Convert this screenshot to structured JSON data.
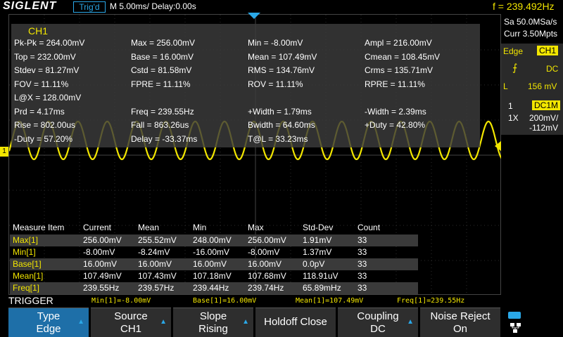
{
  "header": {
    "logo": "SIGLENT",
    "trigger_status": "Trig'd",
    "timebase": "M 5.00ms/ Delay:0.00s",
    "frequency": "f = 239.492Hz"
  },
  "right_panel": {
    "sample_rate": "Sa 50.0MSa/s",
    "memory_depth": "Curr 3.50Mpts",
    "trigger_type": "Edge",
    "trigger_source": "CH1",
    "coupling": "DC",
    "level_label": "L",
    "level_value": "156 mV",
    "channel_number": "1",
    "channel_coupling": "DC1M",
    "probe": "1X",
    "volts_div": "200mV/",
    "offset": "-112mV"
  },
  "measure_panel": {
    "title": "CH1",
    "items": [
      "Pk-Pk = 264.00mV",
      "Max = 256.00mV",
      "Min = -8.00mV",
      "Ampl = 216.00mV",
      "Top = 232.00mV",
      "Base = 16.00mV",
      "Mean = 107.49mV",
      "Cmean = 108.45mV",
      "Stdev = 81.27mV",
      "Cstd = 81.58mV",
      "RMS = 134.76mV",
      "Crms = 135.71mV",
      "FOV = 11.11%",
      "FPRE = 11.11%",
      "ROV = 11.11%",
      "RPRE = 11.11%",
      "L@X = 128.00mV",
      "Prd = 4.17ms",
      "Freq = 239.55Hz",
      "+Width = 1.79ms",
      "-Width = 2.39ms",
      "Rise = 802.00us",
      "Fall = 863.26us",
      "Bwidth = 64.60ms",
      "+Duty = 42.80%",
      "-Duty = 57.20%",
      "Delay = -33.37ms",
      "T@L = 33.23ms"
    ]
  },
  "stats": {
    "headers": [
      "Measure Item",
      "Current",
      "Mean",
      "Min",
      "Max",
      "Std-Dev",
      "Count"
    ],
    "rows": [
      [
        "Max[1]",
        "256.00mV",
        "255.52mV",
        "248.00mV",
        "256.00mV",
        "1.91mV",
        "33"
      ],
      [
        "Min[1]",
        "-8.00mV",
        "-8.24mV",
        "-16.00mV",
        "-8.00mV",
        "1.37mV",
        "33"
      ],
      [
        "Base[1]",
        "16.00mV",
        "16.00mV",
        "16.00mV",
        "16.00mV",
        "0.0pV",
        "33"
      ],
      [
        "Mean[1]",
        "107.49mV",
        "107.43mV",
        "107.18mV",
        "107.68mV",
        "118.91uV",
        "33"
      ],
      [
        "Freq[1]",
        "239.55Hz",
        "239.57Hz",
        "239.44Hz",
        "239.74Hz",
        "65.89mHz",
        "33"
      ]
    ]
  },
  "status_strip": {
    "menu_label": "TRIGGER",
    "items": [
      "Min[1]=-8.00mV",
      "Base[1]=16.00mV",
      "Mean[1]=107.49mV",
      "Freq[1]=239.55Hz"
    ]
  },
  "softkeys": [
    {
      "line1": "Type",
      "line2": "Edge"
    },
    {
      "line1": "Source",
      "line2": "CH1"
    },
    {
      "line1": "Slope",
      "line2": "Rising"
    },
    {
      "line1": "Holdoff Close",
      "line2": ""
    },
    {
      "line1": "Coupling",
      "line2": "DC"
    },
    {
      "line1": "Noise Reject",
      "line2": "On"
    }
  ],
  "channel_marker": "1",
  "colors": {
    "channel1": "#f2e600",
    "accent": "#2aa8e8",
    "active_key": "#1e6fa8"
  }
}
